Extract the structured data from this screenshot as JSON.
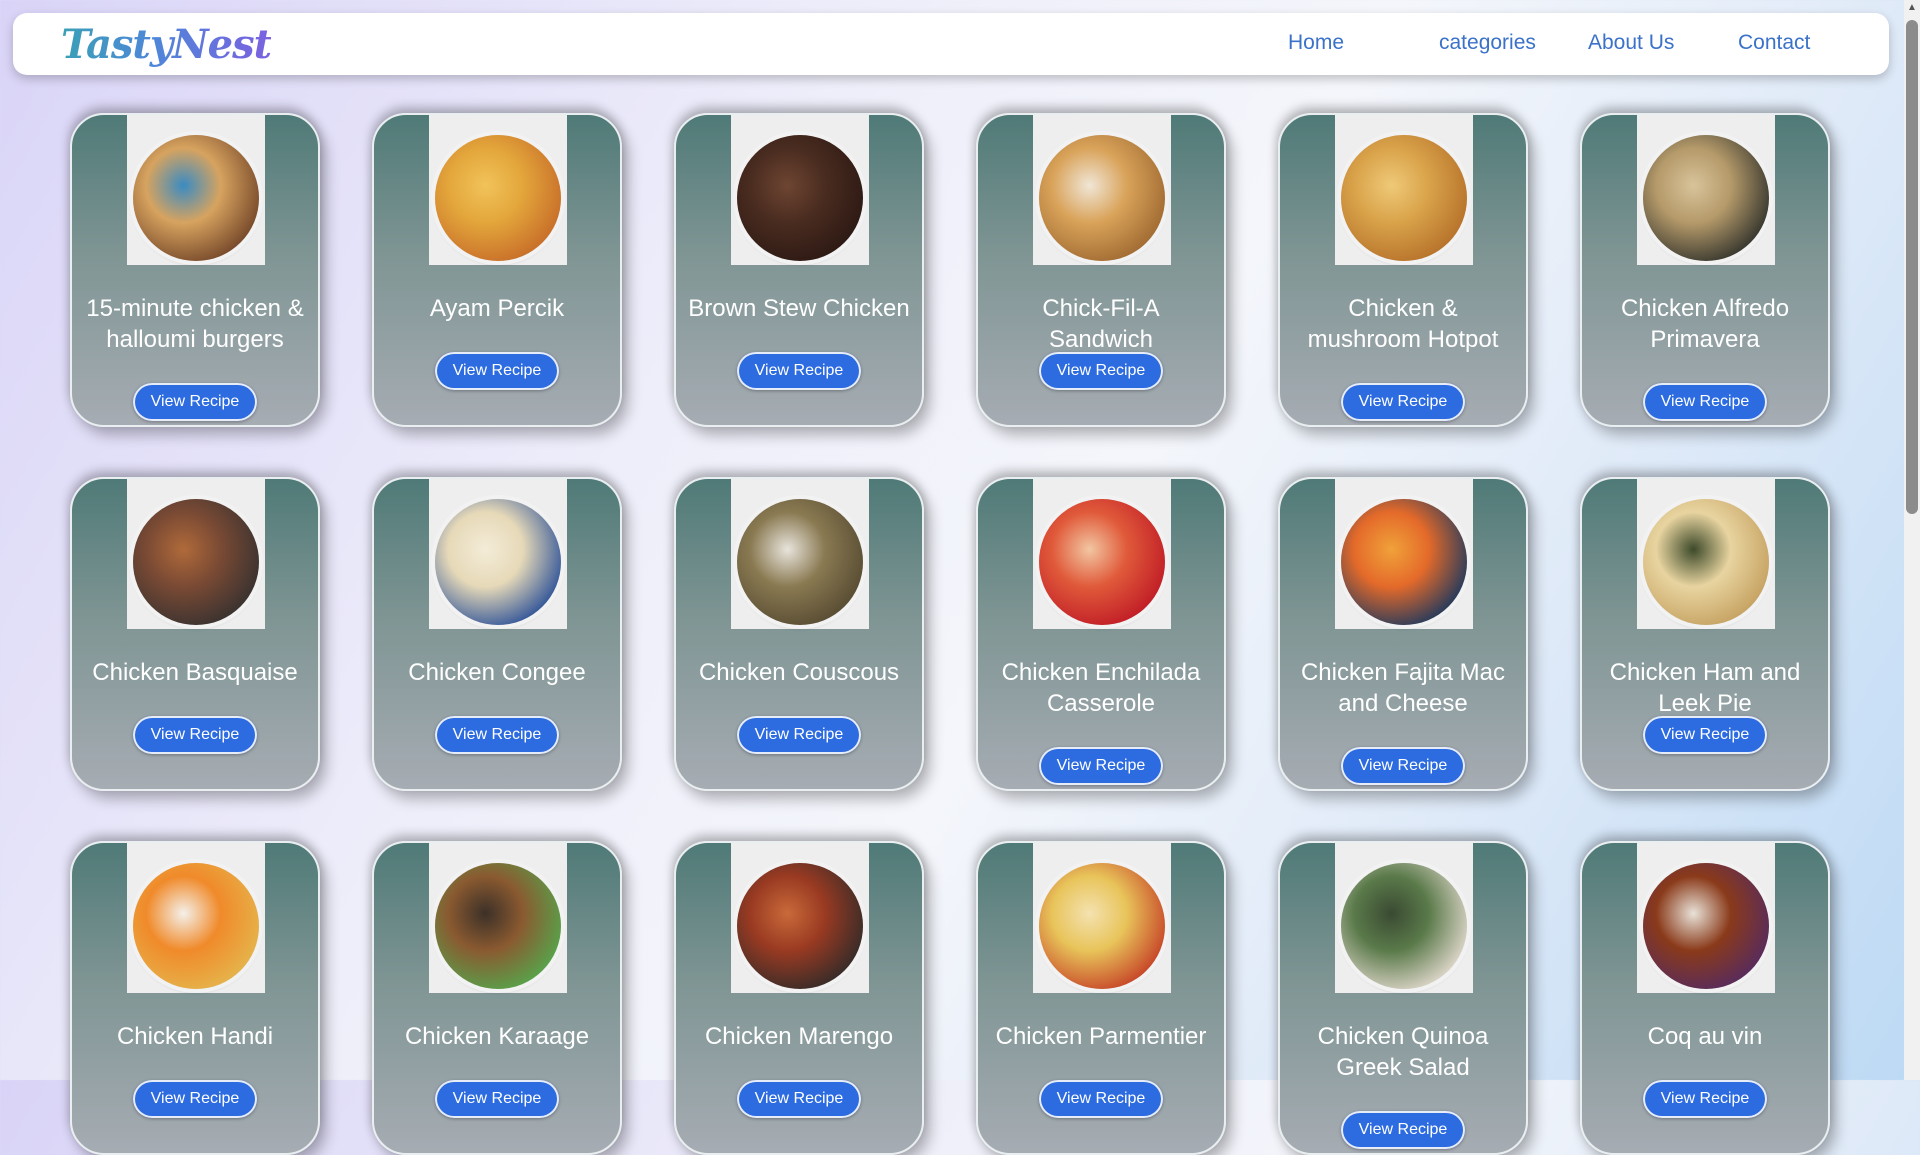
{
  "brand": {
    "logo": "TastyNest"
  },
  "nav": [
    "Home",
    "categories",
    "About Us",
    "Contact"
  ],
  "button_label": "View Recipe",
  "recipes": [
    {
      "title": "15-minute chicken & halloumi burgers",
      "colors": [
        "#d7a35f",
        "#7a4c2c",
        "#3b8bc2"
      ]
    },
    {
      "title": "Ayam Percik",
      "colors": [
        "#e3a63b",
        "#c9702a",
        "#f1c35a"
      ]
    },
    {
      "title": "Brown Stew Chicken",
      "colors": [
        "#4a2c20",
        "#2e1a14",
        "#6e4532"
      ]
    },
    {
      "title": "Chick-Fil-A Sandwich",
      "colors": [
        "#d9a35a",
        "#a36d34",
        "#f0e6d6"
      ]
    },
    {
      "title": "Chicken & mushroom Hotpot",
      "colors": [
        "#d9a34a",
        "#b8742c",
        "#efc978"
      ]
    },
    {
      "title": "Chicken Alfredo Primavera",
      "colors": [
        "#b59a6a",
        "#3b3a30",
        "#d8c39a"
      ]
    },
    {
      "title": "Chicken Basquaise",
      "colors": [
        "#7a4a34",
        "#3c3330",
        "#b06a3a"
      ]
    },
    {
      "title": "Chicken Congee",
      "colors": [
        "#e6d9b8",
        "#3a5b9a",
        "#f4ecd8"
      ]
    },
    {
      "title": "Chicken Couscous",
      "colors": [
        "#8a7a52",
        "#5a4e34",
        "#e8e4dc"
      ]
    },
    {
      "title": "Chicken Enchilada Casserole",
      "colors": [
        "#e05a3a",
        "#c21f27",
        "#f2c6a2"
      ]
    },
    {
      "title": "Chicken Fajita Mac and Cheese",
      "colors": [
        "#e46a2a",
        "#2c3c5a",
        "#f0a23a"
      ]
    },
    {
      "title": "Chicken Ham and Leek Pie",
      "colors": [
        "#e8d4a0",
        "#c7a464",
        "#3d4a2a"
      ]
    },
    {
      "title": "Chicken Handi",
      "colors": [
        "#f08a2a",
        "#e6b24a",
        "#f4f0ea"
      ]
    },
    {
      "title": "Chicken Karaage",
      "colors": [
        "#8a5a30",
        "#5aa04a",
        "#3c3028"
      ]
    },
    {
      "title": "Chicken Marengo",
      "colors": [
        "#9a3a22",
        "#3a2c28",
        "#c86a3a"
      ]
    },
    {
      "title": "Chicken Parmentier",
      "colors": [
        "#e8c45a",
        "#c84a2a",
        "#f4e2b0"
      ]
    },
    {
      "title": "Chicken Quinoa Greek Salad",
      "colors": [
        "#5a7a4a",
        "#d8d2c4",
        "#3a4a32"
      ]
    },
    {
      "title": "Coq au vin",
      "colors": [
        "#8a3a1a",
        "#5a2c5a",
        "#e8e2d8"
      ]
    }
  ]
}
